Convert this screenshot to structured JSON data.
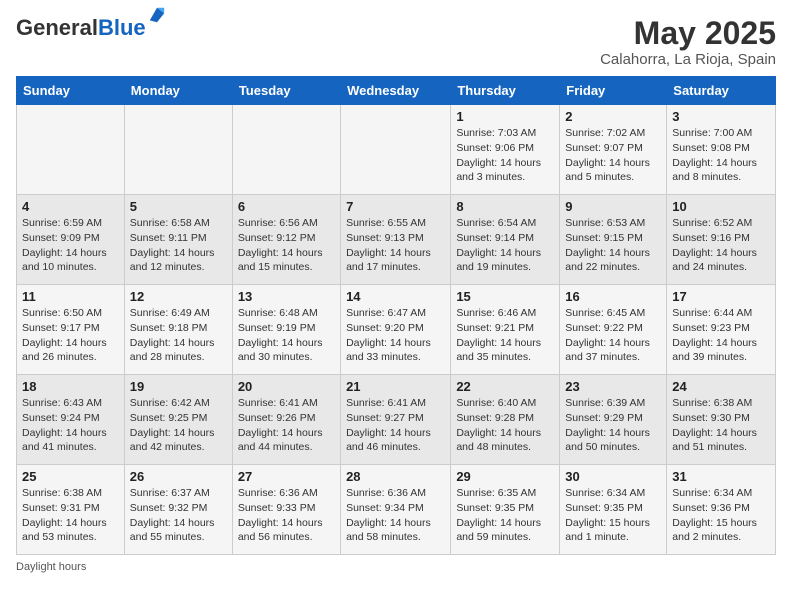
{
  "header": {
    "logo_general": "General",
    "logo_blue": "Blue",
    "month_title": "May 2025",
    "location": "Calahorra, La Rioja, Spain"
  },
  "days_of_week": [
    "Sunday",
    "Monday",
    "Tuesday",
    "Wednesday",
    "Thursday",
    "Friday",
    "Saturday"
  ],
  "weeks": [
    [
      {
        "num": "",
        "info": ""
      },
      {
        "num": "",
        "info": ""
      },
      {
        "num": "",
        "info": ""
      },
      {
        "num": "",
        "info": ""
      },
      {
        "num": "1",
        "info": "Sunrise: 7:03 AM\nSunset: 9:06 PM\nDaylight: 14 hours and 3 minutes."
      },
      {
        "num": "2",
        "info": "Sunrise: 7:02 AM\nSunset: 9:07 PM\nDaylight: 14 hours and 5 minutes."
      },
      {
        "num": "3",
        "info": "Sunrise: 7:00 AM\nSunset: 9:08 PM\nDaylight: 14 hours and 8 minutes."
      }
    ],
    [
      {
        "num": "4",
        "info": "Sunrise: 6:59 AM\nSunset: 9:09 PM\nDaylight: 14 hours and 10 minutes."
      },
      {
        "num": "5",
        "info": "Sunrise: 6:58 AM\nSunset: 9:11 PM\nDaylight: 14 hours and 12 minutes."
      },
      {
        "num": "6",
        "info": "Sunrise: 6:56 AM\nSunset: 9:12 PM\nDaylight: 14 hours and 15 minutes."
      },
      {
        "num": "7",
        "info": "Sunrise: 6:55 AM\nSunset: 9:13 PM\nDaylight: 14 hours and 17 minutes."
      },
      {
        "num": "8",
        "info": "Sunrise: 6:54 AM\nSunset: 9:14 PM\nDaylight: 14 hours and 19 minutes."
      },
      {
        "num": "9",
        "info": "Sunrise: 6:53 AM\nSunset: 9:15 PM\nDaylight: 14 hours and 22 minutes."
      },
      {
        "num": "10",
        "info": "Sunrise: 6:52 AM\nSunset: 9:16 PM\nDaylight: 14 hours and 24 minutes."
      }
    ],
    [
      {
        "num": "11",
        "info": "Sunrise: 6:50 AM\nSunset: 9:17 PM\nDaylight: 14 hours and 26 minutes."
      },
      {
        "num": "12",
        "info": "Sunrise: 6:49 AM\nSunset: 9:18 PM\nDaylight: 14 hours and 28 minutes."
      },
      {
        "num": "13",
        "info": "Sunrise: 6:48 AM\nSunset: 9:19 PM\nDaylight: 14 hours and 30 minutes."
      },
      {
        "num": "14",
        "info": "Sunrise: 6:47 AM\nSunset: 9:20 PM\nDaylight: 14 hours and 33 minutes."
      },
      {
        "num": "15",
        "info": "Sunrise: 6:46 AM\nSunset: 9:21 PM\nDaylight: 14 hours and 35 minutes."
      },
      {
        "num": "16",
        "info": "Sunrise: 6:45 AM\nSunset: 9:22 PM\nDaylight: 14 hours and 37 minutes."
      },
      {
        "num": "17",
        "info": "Sunrise: 6:44 AM\nSunset: 9:23 PM\nDaylight: 14 hours and 39 minutes."
      }
    ],
    [
      {
        "num": "18",
        "info": "Sunrise: 6:43 AM\nSunset: 9:24 PM\nDaylight: 14 hours and 41 minutes."
      },
      {
        "num": "19",
        "info": "Sunrise: 6:42 AM\nSunset: 9:25 PM\nDaylight: 14 hours and 42 minutes."
      },
      {
        "num": "20",
        "info": "Sunrise: 6:41 AM\nSunset: 9:26 PM\nDaylight: 14 hours and 44 minutes."
      },
      {
        "num": "21",
        "info": "Sunrise: 6:41 AM\nSunset: 9:27 PM\nDaylight: 14 hours and 46 minutes."
      },
      {
        "num": "22",
        "info": "Sunrise: 6:40 AM\nSunset: 9:28 PM\nDaylight: 14 hours and 48 minutes."
      },
      {
        "num": "23",
        "info": "Sunrise: 6:39 AM\nSunset: 9:29 PM\nDaylight: 14 hours and 50 minutes."
      },
      {
        "num": "24",
        "info": "Sunrise: 6:38 AM\nSunset: 9:30 PM\nDaylight: 14 hours and 51 minutes."
      }
    ],
    [
      {
        "num": "25",
        "info": "Sunrise: 6:38 AM\nSunset: 9:31 PM\nDaylight: 14 hours and 53 minutes."
      },
      {
        "num": "26",
        "info": "Sunrise: 6:37 AM\nSunset: 9:32 PM\nDaylight: 14 hours and 55 minutes."
      },
      {
        "num": "27",
        "info": "Sunrise: 6:36 AM\nSunset: 9:33 PM\nDaylight: 14 hours and 56 minutes."
      },
      {
        "num": "28",
        "info": "Sunrise: 6:36 AM\nSunset: 9:34 PM\nDaylight: 14 hours and 58 minutes."
      },
      {
        "num": "29",
        "info": "Sunrise: 6:35 AM\nSunset: 9:35 PM\nDaylight: 14 hours and 59 minutes."
      },
      {
        "num": "30",
        "info": "Sunrise: 6:34 AM\nSunset: 9:35 PM\nDaylight: 15 hours and 1 minute."
      },
      {
        "num": "31",
        "info": "Sunrise: 6:34 AM\nSunset: 9:36 PM\nDaylight: 15 hours and 2 minutes."
      }
    ]
  ],
  "footer": {
    "daylight_hours": "Daylight hours"
  }
}
